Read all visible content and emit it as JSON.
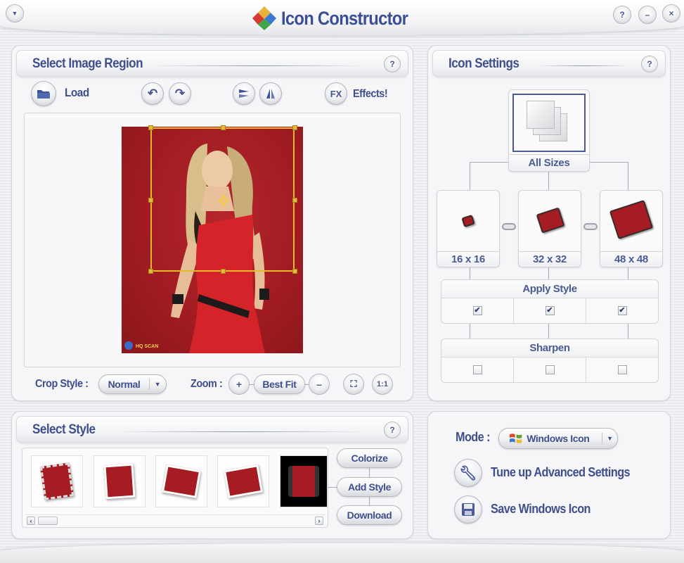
{
  "app": {
    "title": "Icon Constructor",
    "menu_icon": "chevron-down-icon",
    "help_label": "?",
    "minimize_label": "–",
    "close_label": "×"
  },
  "select_image_region": {
    "title": "Select Image Region",
    "help_label": "?",
    "toolbar": {
      "load_label": "Load",
      "undo_icon": "rotate-left-icon",
      "redo_icon": "rotate-right-icon",
      "flip_vertical_icon": "flip-vertical-icon",
      "flip_horizontal_icon": "flip-horizontal-icon",
      "fx_label": "FX",
      "effects_label": "Effects!"
    },
    "preview": {
      "watermark": "HQ SCAN"
    },
    "crop_style": {
      "label": "Crop Style :",
      "value": "Normal"
    },
    "zoom": {
      "label": "Zoom :",
      "plus": "+",
      "best_fit": "Best Fit",
      "minus": "–",
      "actual_size": "1:1"
    }
  },
  "icon_settings": {
    "title": "Icon Settings",
    "help_label": "?",
    "all_sizes_label": "All Sizes",
    "sizes": [
      {
        "label": "16 x 16"
      },
      {
        "label": "32 x 32"
      },
      {
        "label": "48 x 48"
      }
    ],
    "apply_style": {
      "title": "Apply Style",
      "checked": [
        true,
        true,
        true
      ]
    },
    "sharpen": {
      "title": "Sharpen",
      "checked": [
        false,
        false,
        false
      ]
    }
  },
  "select_style": {
    "title": "Select Style",
    "help_label": "?",
    "styles": [
      {
        "name": "postage-stamp"
      },
      {
        "name": "photo-frame"
      },
      {
        "name": "photo-stack-color"
      },
      {
        "name": "photo-stack"
      },
      {
        "name": "film-strip"
      }
    ],
    "buttons": {
      "colorize": "Colorize",
      "add_style": "Add Style",
      "download": "Download"
    },
    "scroll_left": "‹",
    "scroll_right": "›"
  },
  "mode_panel": {
    "mode_label": "Mode :",
    "mode_value": "Windows Icon",
    "tune_up_label": "Tune up Advanced Settings",
    "save_label": "Save Windows Icon"
  },
  "colors": {
    "accent_text": "#3e4f8c",
    "crop_frame": "#e9b92c",
    "photo_background": "#a51d22"
  }
}
